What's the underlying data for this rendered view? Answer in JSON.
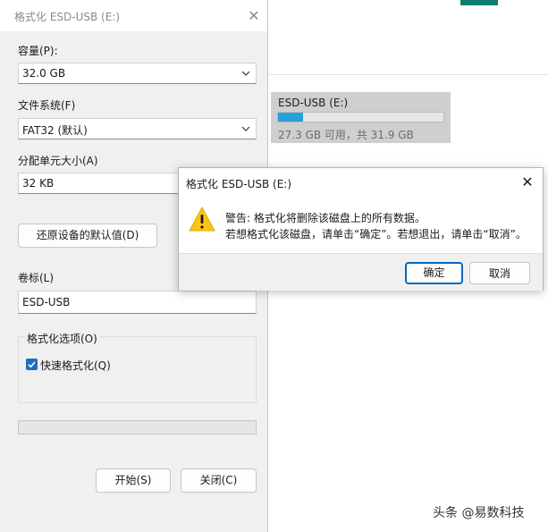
{
  "background": {
    "drive_tile": {
      "name": "ESD-USB (E:)",
      "space_text": "27.3 GB 可用，共 31.9 GB",
      "used_fraction": 0.15
    },
    "accent_color": "#0f7b6c"
  },
  "format_window": {
    "title": "格式化 ESD-USB (E:)",
    "capacity_label": "容量(P):",
    "capacity_value": "32.0 GB",
    "filesystem_label": "文件系统(F)",
    "filesystem_value": "FAT32 (默认)",
    "unit_label": "分配单元大小(A)",
    "unit_value": "32 KB",
    "restore_button": "还原设备的默认值(D)",
    "volume_label": "卷标(L)",
    "volume_value": "ESD-USB",
    "options_group": "格式化选项(O)",
    "quick_format_label": "快速格式化(Q)",
    "quick_format_checked": true,
    "progress": 0,
    "start_button": "开始(S)",
    "close_button": "关闭(C)"
  },
  "warning_dialog": {
    "title": "格式化 ESD-USB (E:)",
    "line1": "警告: 格式化将删除该磁盘上的所有数据。",
    "line2": "若想格式化该磁盘，请单击“确定”。若想退出，请单击“取消”。",
    "ok_button": "确定",
    "cancel_button": "取消",
    "icon": "warning-icon",
    "primary_color": "#0067c0"
  },
  "watermark": "头条 @易数科技"
}
